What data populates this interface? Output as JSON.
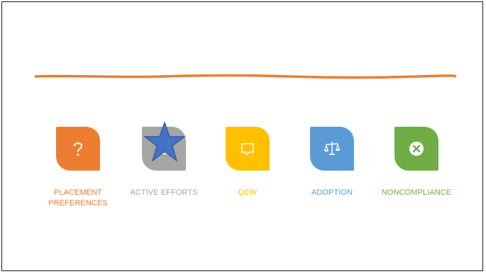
{
  "slide": {
    "accent_rule_color": "#ED7D31"
  },
  "items": [
    {
      "label": "PLACEMENT PREFERENCES",
      "icon": "question-mark-icon",
      "color": "#ED7D31"
    },
    {
      "label": "ACTIVE EFFORTS",
      "icon": "laptop-icon",
      "color": "#A5A5A5"
    },
    {
      "label": "QEW",
      "icon": "speech-bubble-icon",
      "color": "#FFC000"
    },
    {
      "label": "ADOPTION",
      "icon": "scales-icon",
      "color": "#5B9BD5"
    },
    {
      "label": "NONCOMPLIANCE",
      "icon": "close-circle-icon",
      "color": "#70AD47"
    }
  ],
  "overlay": {
    "shape": "star-icon",
    "fill": "#4472C4",
    "stroke": "#2F5597"
  }
}
